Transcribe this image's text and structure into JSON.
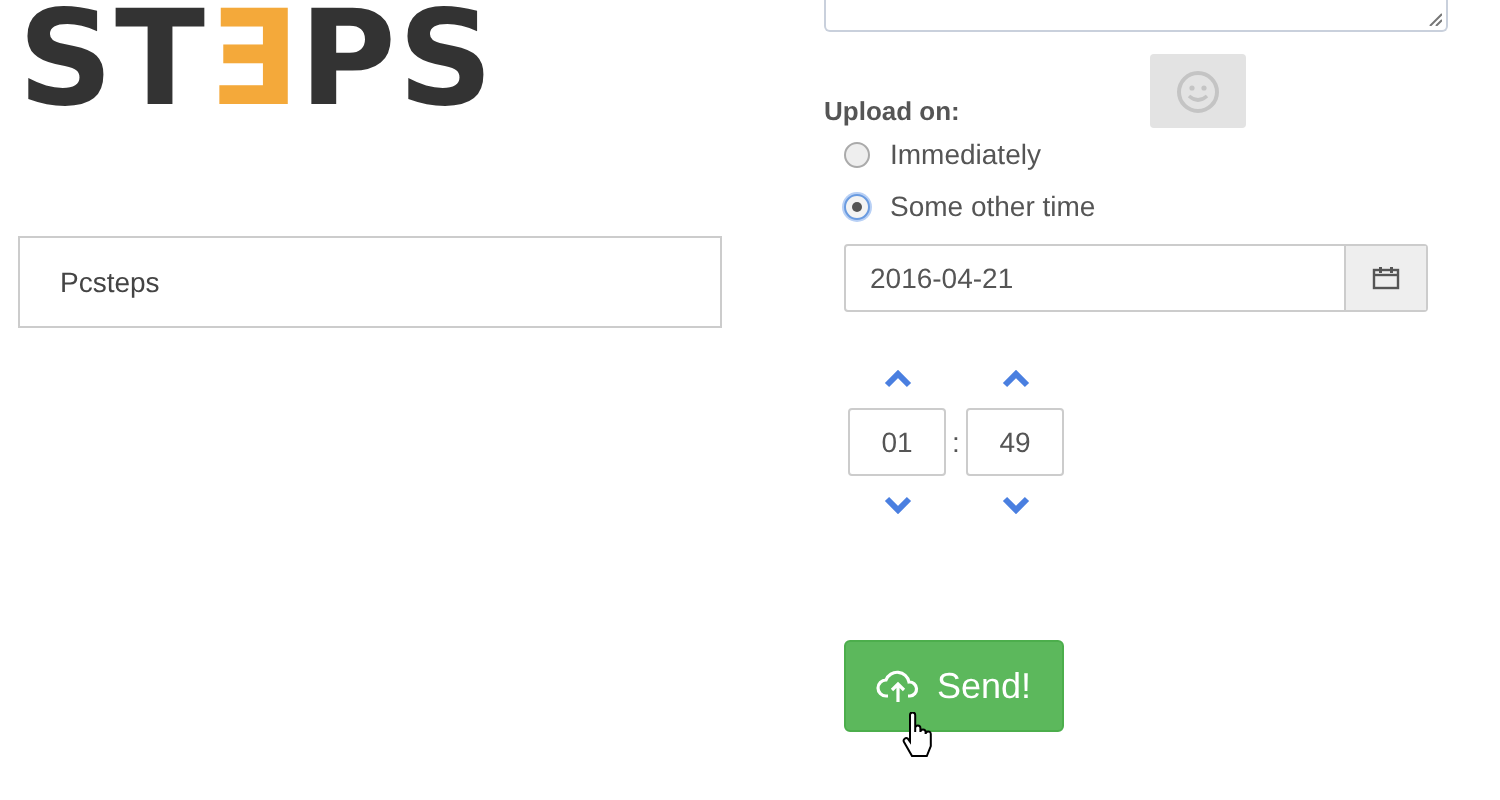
{
  "logo": [
    {
      "text": "ST",
      "accent": false
    },
    {
      "text": "Ǝ",
      "accent": true
    },
    {
      "text": "PS",
      "accent": false
    }
  ],
  "name_field": {
    "value": "Pcsteps"
  },
  "upload": {
    "label": "Upload on:",
    "options": [
      {
        "label": "Immediately",
        "selected": false
      },
      {
        "label": "Some other time",
        "selected": true
      }
    ],
    "date": {
      "value": "2016-04-21"
    },
    "time": {
      "hours": "01",
      "separator": ":",
      "minutes": "49"
    }
  },
  "send_button": {
    "label": "Send!"
  }
}
